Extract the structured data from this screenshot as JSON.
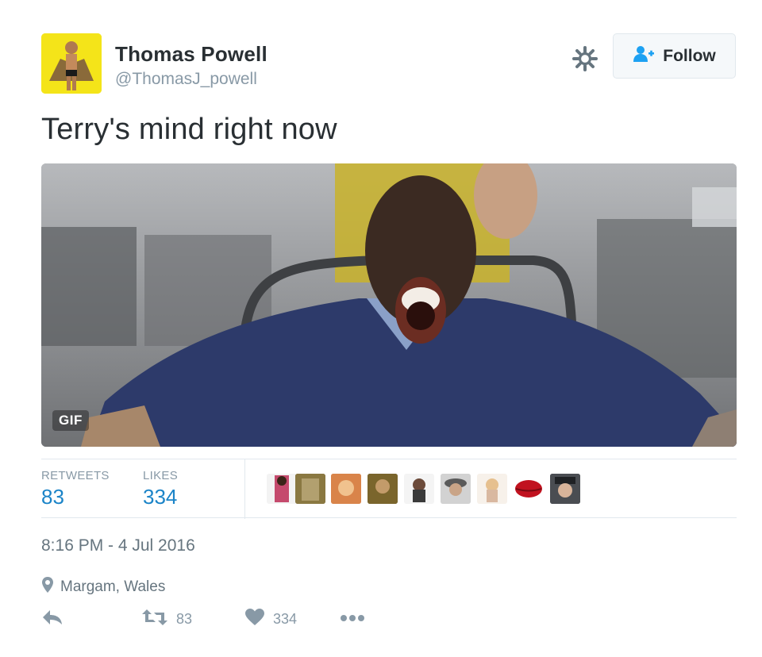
{
  "author": {
    "name": "Thomas Powell",
    "handle": "@ThomasJ_powell",
    "avatar_bg": "#f4e419"
  },
  "follow": {
    "label": "Follow",
    "icon": "follow-user-icon"
  },
  "settings": {
    "icon": "gear-icon"
  },
  "tweet": {
    "text": "Terry's mind right now"
  },
  "media": {
    "badge": "GIF",
    "type": "animated-gif"
  },
  "stats": {
    "retweets_label": "RETWEETS",
    "retweets": "83",
    "likes_label": "LIKES",
    "likes": "334",
    "likers_count_shown": 9
  },
  "meta": {
    "timestamp": "8:16 PM - 4 Jul 2016",
    "location": "Margam, Wales",
    "location_icon": "map-pin-icon"
  },
  "actions": {
    "reply_icon": "reply-icon",
    "retweet_icon": "retweet-icon",
    "retweet_count": "83",
    "like_icon": "heart-icon",
    "like_count": "334",
    "more_icon": "more-dots-icon"
  },
  "colors": {
    "link_blue": "#1b84c8",
    "muted": "#8899a6",
    "text": "#292f33",
    "follow_icon_blue": "#1da1f2"
  }
}
